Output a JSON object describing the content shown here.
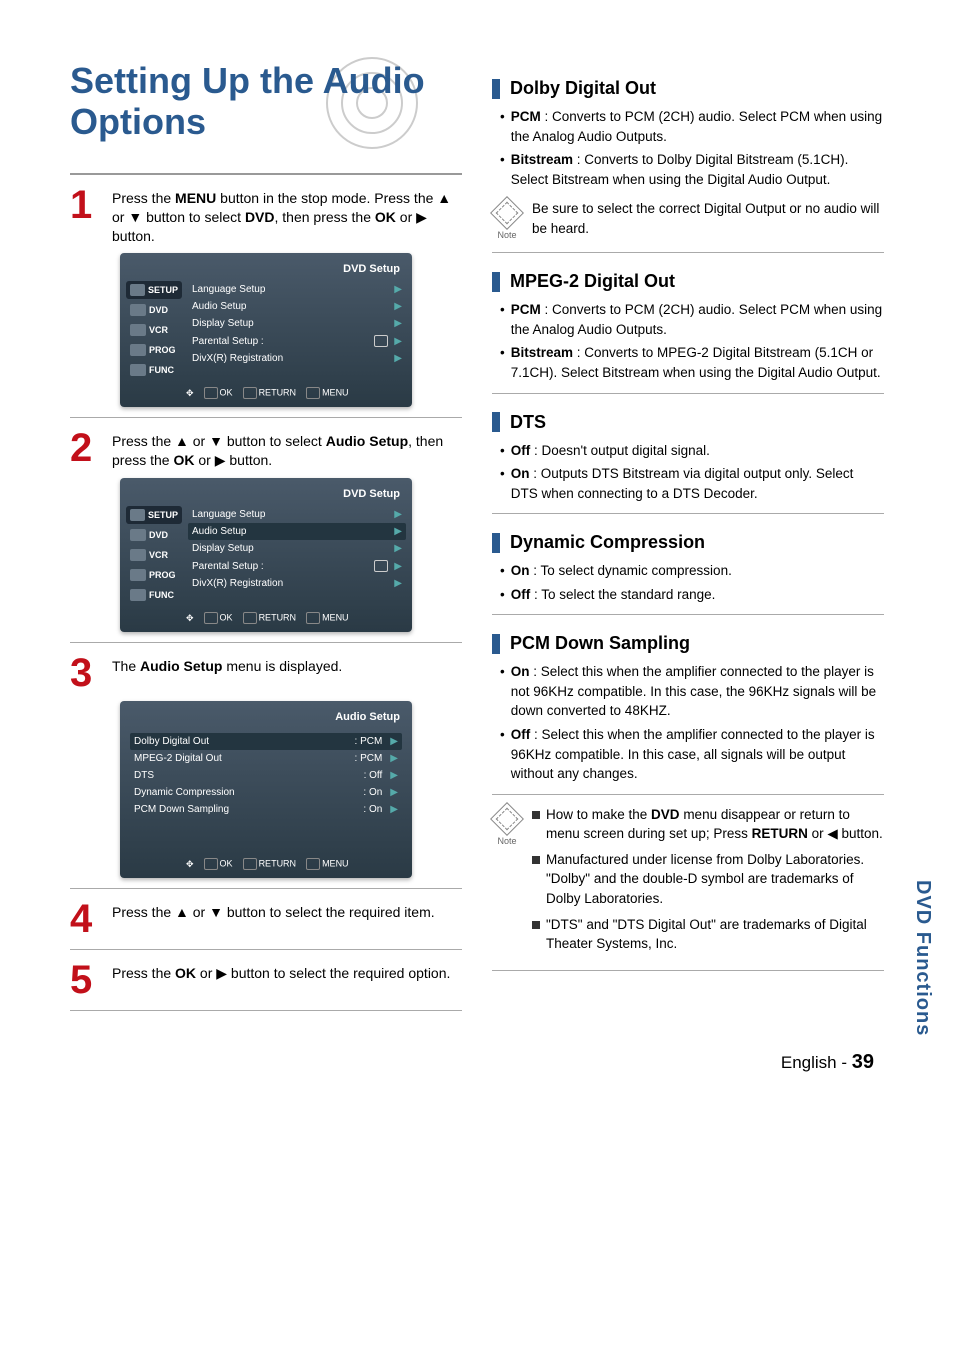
{
  "title": "Setting Up the Audio Options",
  "side_tab": "DVD Functions",
  "footer": {
    "lang": "English - ",
    "page": "39"
  },
  "steps": {
    "s1": {
      "num": "1",
      "text_parts": [
        "Press the ",
        "MENU",
        " button in the stop mode. Press the ▲ or ▼ button to select ",
        "DVD",
        ", then press the ",
        "OK",
        " or ▶ button."
      ]
    },
    "s2": {
      "num": "2",
      "text_parts": [
        "Press the ▲ or ▼ button to select ",
        "Audio Setup",
        ", then press the ",
        "OK",
        " or ▶ button."
      ]
    },
    "s3": {
      "num": "3",
      "text_parts": [
        "The ",
        "Audio Setup",
        " menu is displayed."
      ]
    },
    "s4": {
      "num": "4",
      "text": "Press the ▲ or ▼ button to select the required item."
    },
    "s5": {
      "num": "5",
      "text_parts": [
        "Press the ",
        "OK",
        " or ▶ button to select the required option."
      ]
    }
  },
  "osd1": {
    "header": "DVD  Setup",
    "side": [
      "SETUP",
      "DVD",
      "VCR",
      "PROG",
      "FUNC"
    ],
    "rows": [
      {
        "label": "Language Setup"
      },
      {
        "label": "Audio Setup"
      },
      {
        "label": "Display Setup"
      },
      {
        "label": "Parental Setup :",
        "lock": true
      },
      {
        "label": "DivX(R) Registration"
      }
    ],
    "footer": [
      "OK",
      "RETURN",
      "MENU"
    ]
  },
  "osd2": {
    "header": "DVD  Setup",
    "side": [
      "SETUP",
      "DVD",
      "VCR",
      "PROG",
      "FUNC"
    ],
    "rows": [
      {
        "label": "Language Setup"
      },
      {
        "label": "Audio Setup",
        "hl": true
      },
      {
        "label": "Display Setup"
      },
      {
        "label": "Parental Setup :",
        "lock": true
      },
      {
        "label": "DivX(R) Registration"
      }
    ],
    "footer": [
      "OK",
      "RETURN",
      "MENU"
    ]
  },
  "osd3": {
    "header": "Audio Setup",
    "rows": [
      {
        "label": "Dolby Digital Out",
        "val": ": PCM",
        "hl": true
      },
      {
        "label": "MPEG-2 Digital Out",
        "val": ": PCM"
      },
      {
        "label": "DTS",
        "val": ": Off"
      },
      {
        "label": "Dynamic Compression",
        "val": ": On"
      },
      {
        "label": "PCM Down Sampling",
        "val": ": On"
      }
    ],
    "footer": [
      "OK",
      "RETURN",
      "MENU"
    ]
  },
  "right": {
    "dolby": {
      "title": "Dolby Digital Out",
      "items": [
        {
          "key": "PCM",
          "lead": " : ",
          "text": "Converts to PCM (2CH) audio. Select PCM when using the Analog Audio Outputs."
        },
        {
          "key": "Bitstream",
          "lead": " : ",
          "text": "Converts to Dolby Digital Bitstream (5.1CH). Select Bitstream when using the Digital Audio Output."
        }
      ],
      "note": "Be sure to select the correct Digital Output or no audio will be heard."
    },
    "mpeg": {
      "title": "MPEG-2 Digital Out",
      "items": [
        {
          "key": "PCM",
          "lead": " : ",
          "text": "Converts to PCM (2CH) audio. Select PCM when using the Analog  Audio Outputs."
        },
        {
          "key": "Bitstream",
          "lead": " : ",
          "text": "Converts to MPEG-2 Digital Bitstream (5.1CH or 7.1CH). Select Bitstream when using the Digital Audio Output."
        }
      ]
    },
    "dts": {
      "title": "DTS",
      "items": [
        {
          "key": "Off",
          "lead": " : ",
          "text": "Doesn't output digital signal."
        },
        {
          "key": "On",
          "lead": " : ",
          "text": "Outputs DTS Bitstream via digital output only. Select DTS when connecting to a DTS Decoder."
        }
      ]
    },
    "dyn": {
      "title": "Dynamic Compression",
      "items": [
        {
          "key": "On",
          "lead": " : ",
          "text": "To select dynamic compression."
        },
        {
          "key": "Off",
          "lead": " : ",
          "text": "To select the standard range."
        }
      ]
    },
    "pcm": {
      "title": "PCM Down Sampling",
      "items": [
        {
          "key": "On",
          "lead": " : ",
          "text": "Select this when the amplifier connected to the player is not 96KHz compatible. In this case, the 96KHz signals will be down converted to 48KHZ."
        },
        {
          "key": "Off",
          "lead": " : ",
          "text": "Select this when the amplifier connected to the player is 96KHz compatible. In this case, all signals will be output without any changes."
        }
      ]
    },
    "notes": {
      "label": "Note",
      "items": [
        {
          "pre": "How to make the ",
          "bold": "DVD",
          "post": " menu disappear or return to menu screen during set up; Press ",
          "bold2": "RETURN",
          "post2": " or ◀ button."
        },
        {
          "text": "Manufactured under license from Dolby Laboratories. \"Dolby\" and the double-D symbol are trademarks of Dolby Laboratories."
        },
        {
          "text": "\"DTS\" and \"DTS Digital Out\" are trademarks of Digital Theater Systems, Inc."
        }
      ]
    }
  }
}
